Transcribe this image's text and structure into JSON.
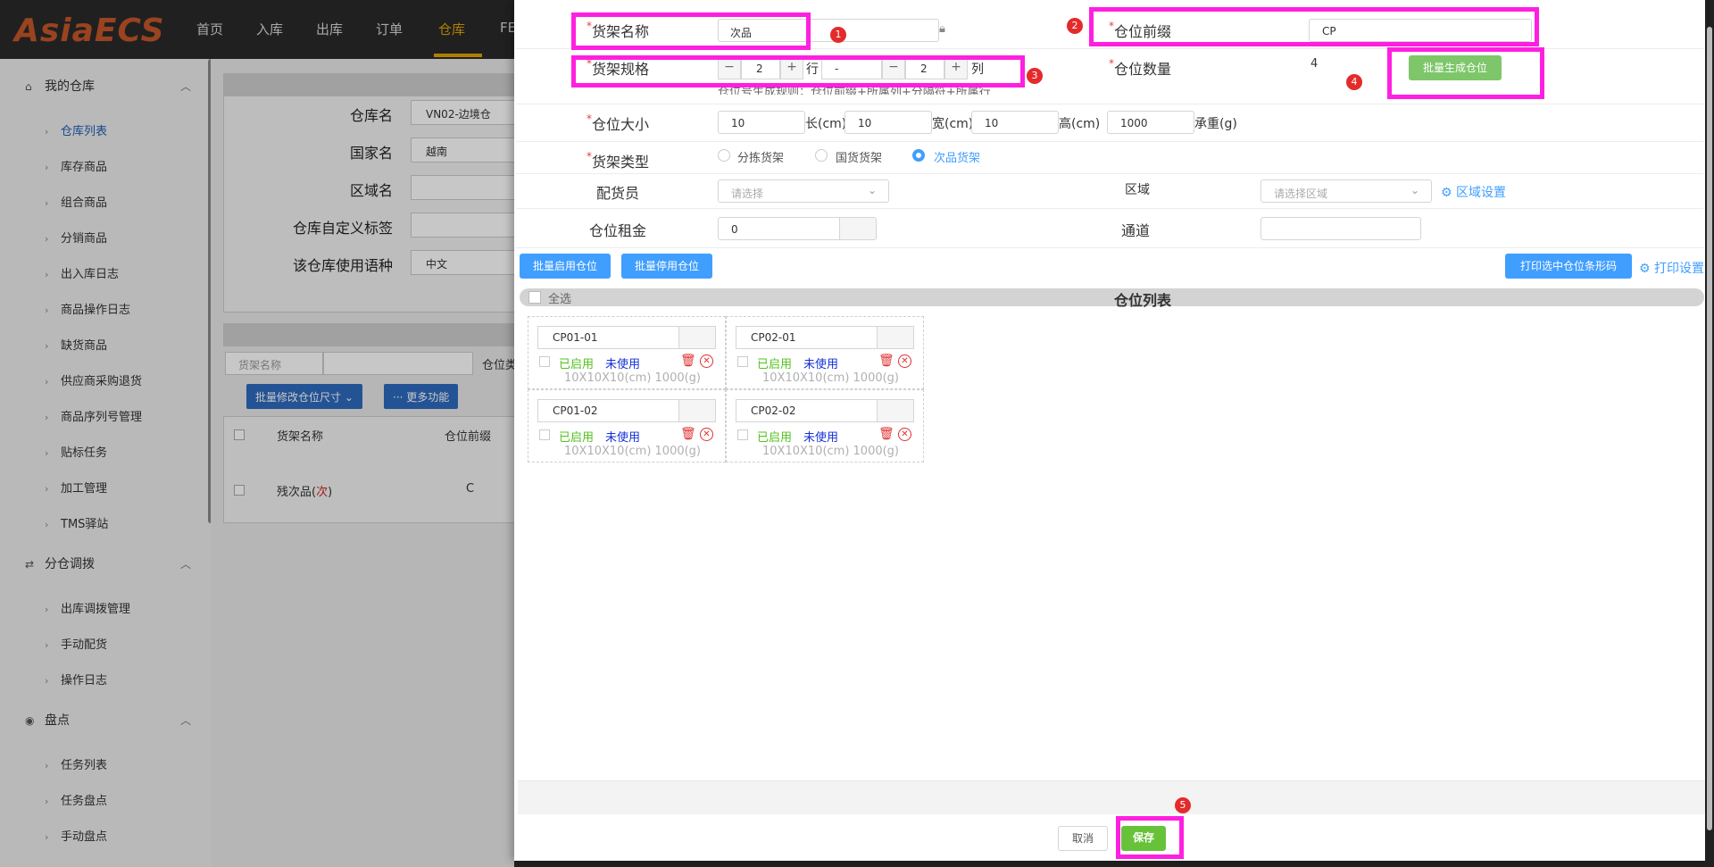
{
  "logo": "AsiaECS",
  "nav": [
    "首页",
    "入库",
    "出库",
    "订单",
    "仓库",
    "FE"
  ],
  "sidebar": {
    "groups": [
      {
        "label": "我的仓库",
        "icon": "warehouse-icon",
        "items": [
          "仓库列表",
          "库存商品",
          "组合商品",
          "分销商品",
          "出入库日志",
          "商品操作日志",
          "缺货商品",
          "供应商采购退货",
          "商品序列号管理",
          "贴标任务",
          "加工管理",
          "TMS驿站"
        ]
      },
      {
        "label": "分仓调拨",
        "icon": "transfer-icon",
        "items": [
          "出库调拨管理",
          "手动配货",
          "操作日志"
        ]
      },
      {
        "label": "盘点",
        "icon": "eye-icon",
        "items": [
          "任务列表",
          "任务盘点",
          "手动盘点"
        ]
      }
    ]
  },
  "bg": {
    "labels": [
      "仓库名",
      "国家名",
      "区域名",
      "仓库自定义标签",
      "该仓库使用语种"
    ],
    "values": [
      "VN02-边境仓",
      "越南",
      "",
      "",
      "中文"
    ],
    "search_select": "货架名称",
    "pos_label": "仓位类",
    "btn_batch_size": "批量修改仓位尺寸",
    "btn_more": "更多功能",
    "col_name": "货架名称",
    "col_prefix": "仓位前缀",
    "row_name": "残次品(",
    "row_name_red": "次",
    "row_name_end": ")",
    "row_prefix": "C"
  },
  "form": {
    "shelf_name_label": "货架名称",
    "shelf_name_value": "次品",
    "prefix_label": "仓位前缀",
    "prefix_value": "CP",
    "spec_label": "货架规格",
    "rows_value": "2",
    "row_unit": "行",
    "separator": "-",
    "cols_value": "2",
    "col_unit": "列",
    "rule_text": "仓位号生成规则：仓位前缀+所属列+分隔符+所属行",
    "count_label": "仓位数量",
    "count_value": "4",
    "gen_btn": "批量生成仓位",
    "size_label": "仓位大小",
    "length": "10",
    "length_unit": "长(cm)",
    "width": "10",
    "width_unit": "宽(cm)",
    "height": "10",
    "height_unit": "高(cm)",
    "weight": "1000",
    "weight_unit": "承重(g)",
    "type_label": "货架类型",
    "type_options": [
      "分拣货架",
      "国货货架",
      "次品货架"
    ],
    "type_selected": 2,
    "picker_label": "配货员",
    "picker_placeholder": "请选择",
    "area_label": "区域",
    "area_placeholder": "请选择区域",
    "area_settings": "区域设置",
    "rent_label": "仓位租金",
    "rent_value": "0",
    "channel_label": "通道",
    "channel_value": ""
  },
  "actions": {
    "enable_btn": "批量启用仓位",
    "disable_btn": "批量停用仓位",
    "print_btn": "打印选中仓位条形码",
    "print_settings": "打印设置"
  },
  "list": {
    "select_all": "全选",
    "title": "仓位列表",
    "cells": [
      {
        "code": "CP01-01",
        "status_on": "已启用",
        "status_use": "未使用",
        "size": "10X10X10(cm) 1000(g)"
      },
      {
        "code": "CP02-01",
        "status_on": "已启用",
        "status_use": "未使用",
        "size": "10X10X10(cm) 1000(g)"
      },
      {
        "code": "CP01-02",
        "status_on": "已启用",
        "status_use": "未使用",
        "size": "10X10X10(cm) 1000(g)"
      },
      {
        "code": "CP02-02",
        "status_on": "已启用",
        "status_use": "未使用",
        "size": "10X10X10(cm) 1000(g)"
      }
    ]
  },
  "footer": {
    "cancel": "取消",
    "save": "保存"
  },
  "badges": [
    "1",
    "2",
    "3",
    "4",
    "5"
  ],
  "colors": {
    "highlight": "#ff1fe0",
    "badge": "#e42b2b",
    "primary": "#409eff",
    "success": "#7ec66a"
  }
}
